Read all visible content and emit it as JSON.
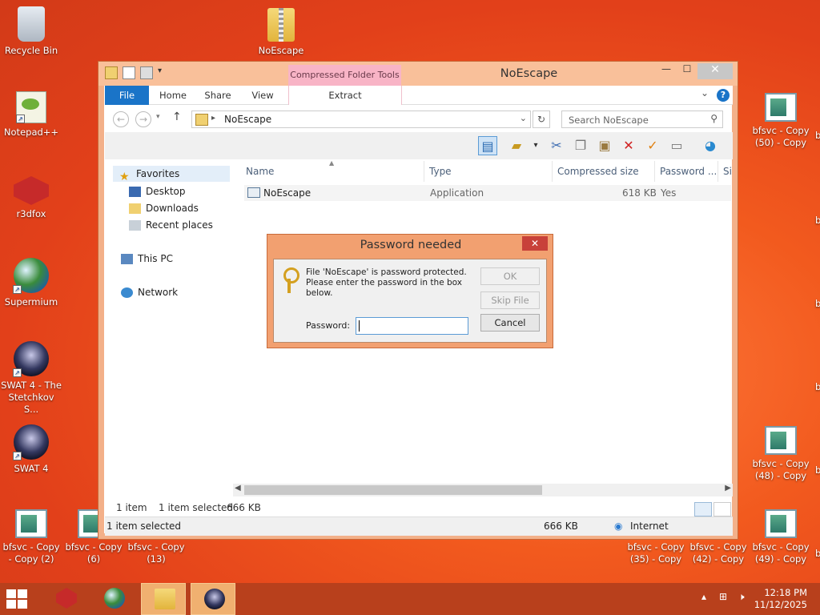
{
  "desktop": {
    "icons": [
      {
        "label": "Recycle Bin"
      },
      {
        "label": "NoEscape"
      },
      {
        "label": "Notepad++"
      },
      {
        "label": "r3dfox"
      },
      {
        "label": "Supermium"
      },
      {
        "label": "SWAT 4 - The Stetchkov S..."
      },
      {
        "label": "SWAT 4"
      },
      {
        "label": "bfsvc - Copy - Copy (2)"
      },
      {
        "label": "bfsvc - Copy (6)"
      },
      {
        "label": "bfsvc - Copy (13)"
      },
      {
        "label": "bfsvc - Copy (50) - Copy"
      },
      {
        "label": "bfsvc - Copy (48) - Copy"
      },
      {
        "label": "bfsvc - Copy (35) - Copy"
      },
      {
        "label": "bfsvc - Copy (42) - Copy"
      },
      {
        "label": "bfsvc - Copy (49) - Copy"
      }
    ],
    "edge_letter": "b"
  },
  "explorer": {
    "title": "NoEscape",
    "context_tab": "Compressed Folder Tools",
    "ribbon_tabs": [
      "File",
      "Home",
      "Share",
      "View",
      "Extract"
    ],
    "address": "NoEscape",
    "search_placeholder": "Search NoEscape",
    "nav": {
      "favorites": "Favorites",
      "desktop": "Desktop",
      "downloads": "Downloads",
      "recent": "Recent places",
      "this_pc": "This PC",
      "network": "Network"
    },
    "columns": [
      "Name",
      "Type",
      "Compressed size",
      "Password ...",
      "Si"
    ],
    "files": [
      {
        "name": "NoEscape",
        "type": "Application",
        "size": "618 KB",
        "password": "Yes"
      }
    ],
    "status": {
      "count": "1 item",
      "selected": "1 item selected",
      "size": "666 KB"
    },
    "statusbar": {
      "selected": "1 item selected",
      "size": "666 KB",
      "zone": "Internet"
    }
  },
  "dialog": {
    "title": "Password needed",
    "message": "File 'NoEscape' is password protected. Please enter the password in the box below.",
    "ok": "OK",
    "skip": "Skip File",
    "cancel": "Cancel",
    "password_label": "Password:",
    "password_value": ""
  },
  "taskbar": {
    "time": "12:18 PM",
    "date": "11/12/2025"
  }
}
